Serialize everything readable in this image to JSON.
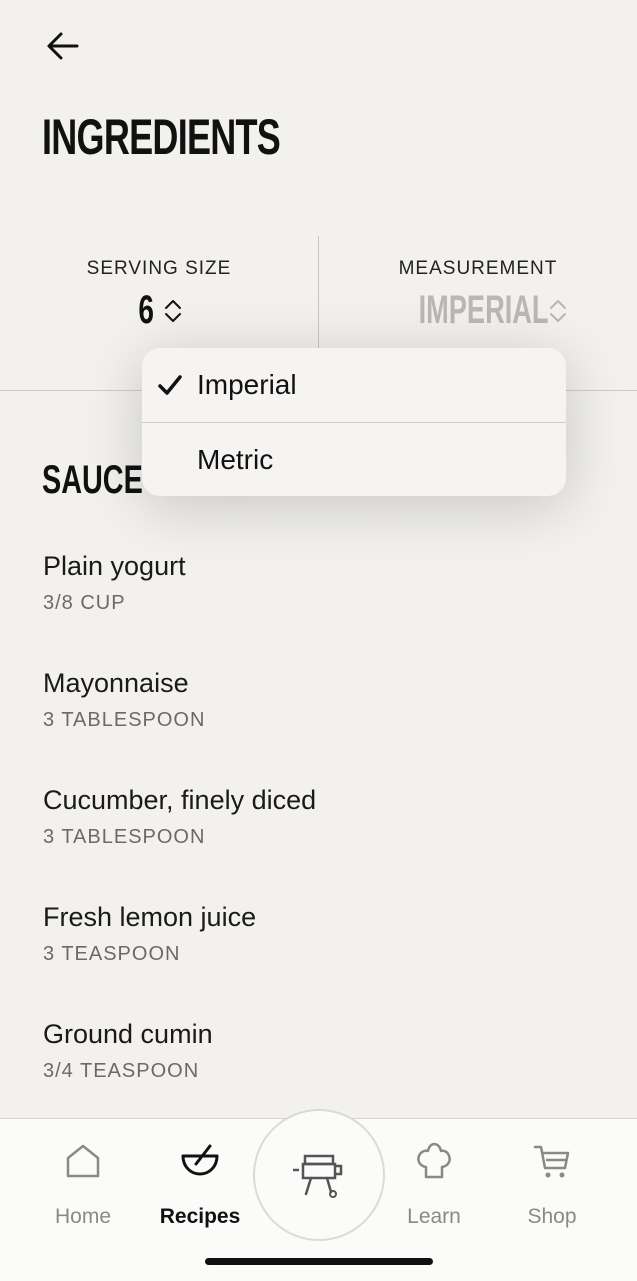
{
  "header": {
    "title": "INGREDIENTS"
  },
  "serving": {
    "label": "SERVING SIZE",
    "value": "6"
  },
  "measurement": {
    "label": "MEASUREMENT",
    "value": "IMPERIAL"
  },
  "dropdown": {
    "options": [
      {
        "label": "Imperial",
        "selected": true
      },
      {
        "label": "Metric",
        "selected": false
      }
    ]
  },
  "section": {
    "title": "SAUCE"
  },
  "ingredients": [
    {
      "name": "Plain yogurt",
      "amount": "3/8 CUP"
    },
    {
      "name": "Mayonnaise",
      "amount": "3 TABLESPOON"
    },
    {
      "name": "Cucumber, finely diced",
      "amount": "3 TABLESPOON"
    },
    {
      "name": "Fresh lemon juice",
      "amount": "3 TEASPOON"
    },
    {
      "name": "Ground cumin",
      "amount": "3/4 TEASPOON"
    }
  ],
  "tabbar": {
    "tabs": [
      {
        "label": "Home",
        "icon": "home-icon",
        "active": false
      },
      {
        "label": "Recipes",
        "icon": "bowl-icon",
        "active": true
      },
      {
        "label": "Learn",
        "icon": "chef-hat-icon",
        "active": false
      },
      {
        "label": "Shop",
        "icon": "cart-icon",
        "active": false
      }
    ],
    "center_icon": "grill-icon"
  },
  "colors": {
    "background": "#f2f1ee",
    "muted": "#b9b8b6",
    "text": "#1a1a1a"
  }
}
